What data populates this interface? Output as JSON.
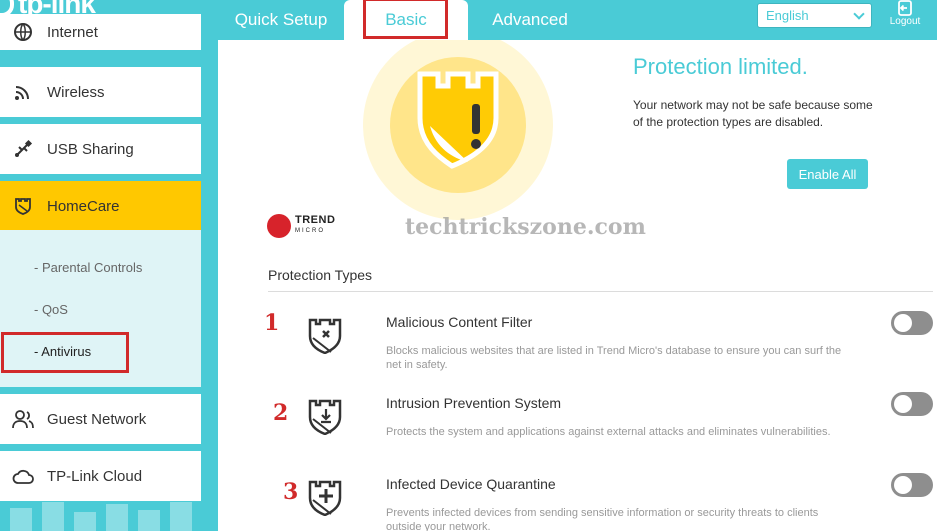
{
  "brand": {
    "logo_text": "tp-link"
  },
  "header": {
    "tabs": [
      {
        "label": "Quick Setup"
      },
      {
        "label": "Basic"
      },
      {
        "label": "Advanced"
      }
    ],
    "language": "English",
    "logout_label": "Logout"
  },
  "sidebar": {
    "items": [
      {
        "label": "Internet",
        "icon": "globe-icon"
      },
      {
        "label": "Wireless",
        "icon": "wifi-icon"
      },
      {
        "label": "USB Sharing",
        "icon": "usb-icon"
      },
      {
        "label": "HomeCare",
        "icon": "shield-icon"
      },
      {
        "label": "Guest Network",
        "icon": "guest-users-icon"
      },
      {
        "label": "TP-Link Cloud",
        "icon": "cloud-icon"
      }
    ],
    "submenu": [
      {
        "label": "- Parental Controls"
      },
      {
        "label": "- QoS"
      },
      {
        "label": "- Antivirus"
      }
    ]
  },
  "status": {
    "title": "Protection limited.",
    "description": "Your network may not be safe because some of the protection types are disabled.",
    "enable_all_label": "Enable All"
  },
  "partner": {
    "name": "TREND",
    "sub": "MICRO"
  },
  "watermark": "techtrickszone.com",
  "protection": {
    "section_title": "Protection Types",
    "types": [
      {
        "number": "1",
        "name": "Malicious Content Filter",
        "description": "Blocks malicious websites that are listed in Trend Micro's database to ensure you can surf the net in safety.",
        "enabled": false,
        "icon": "shield-x-icon"
      },
      {
        "number": "2",
        "name": "Intrusion Prevention System",
        "description": "Protects the system and applications against external attacks and eliminates vulnerabilities.",
        "enabled": false,
        "icon": "shield-download-icon"
      },
      {
        "number": "3",
        "name": "Infected Device Quarantine",
        "description": "Prevents infected devices from sending sensitive information or security threats to clients outside your network.",
        "enabled": false,
        "icon": "shield-plus-icon"
      }
    ]
  },
  "colors": {
    "accent": "#4acbd6",
    "active": "#ffc800",
    "highlight": "#d12a2a",
    "toggle_off": "#8e8e8e"
  }
}
